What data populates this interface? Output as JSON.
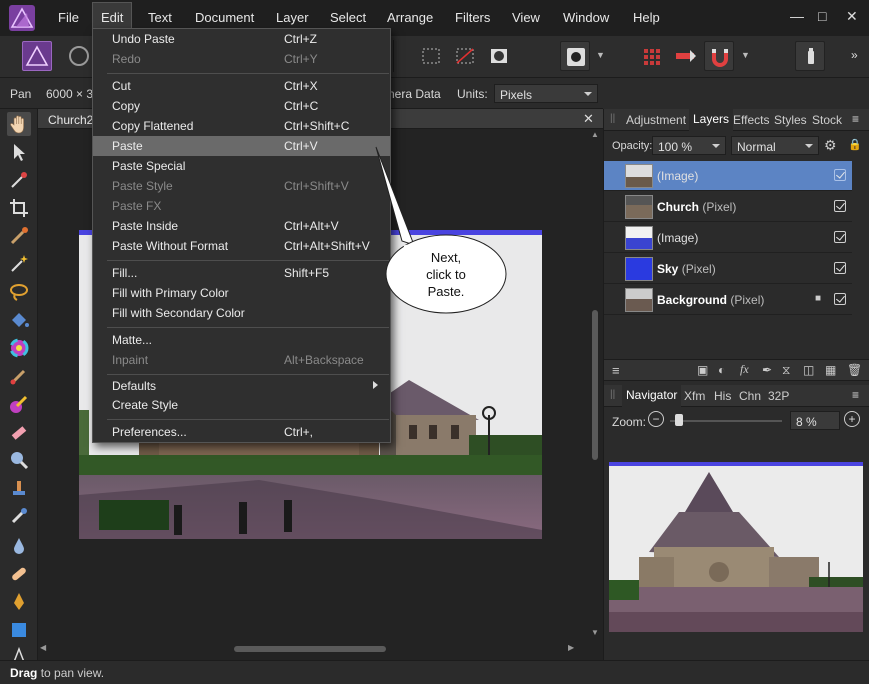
{
  "menubar": {
    "items": [
      "File",
      "Edit",
      "Text",
      "Document",
      "Layer",
      "Select",
      "Arrange",
      "Filters",
      "View",
      "Window",
      "Help"
    ]
  },
  "context_bar": {
    "tool_name": "Pan",
    "doc_size": "6000 × 3",
    "camera_data": "nera Data",
    "units_label": "Units:",
    "units_value": "Pixels"
  },
  "document": {
    "tab_label": "Church2"
  },
  "edit_menu": {
    "items": [
      {
        "label": "Undo Paste",
        "shortcut": "Ctrl+Z",
        "disabled": false
      },
      {
        "label": "Redo",
        "shortcut": "Ctrl+Y",
        "disabled": true
      },
      {
        "label": "Cut",
        "shortcut": "Ctrl+X",
        "disabled": false
      },
      {
        "label": "Copy",
        "shortcut": "Ctrl+C",
        "disabled": false
      },
      {
        "label": "Copy Flattened",
        "shortcut": "Ctrl+Shift+C",
        "disabled": false
      },
      {
        "label": "Paste",
        "shortcut": "Ctrl+V",
        "disabled": false,
        "highlighted": true
      },
      {
        "label": "Paste Special",
        "shortcut": "",
        "disabled": false
      },
      {
        "label": "Paste Style",
        "shortcut": "Ctrl+Shift+V",
        "disabled": true
      },
      {
        "label": "Paste FX",
        "shortcut": "",
        "disabled": true
      },
      {
        "label": "Paste Inside",
        "shortcut": "Ctrl+Alt+V",
        "disabled": false
      },
      {
        "label": "Paste Without Format",
        "shortcut": "Ctrl+Alt+Shift+V",
        "disabled": false
      },
      {
        "label": "Fill...",
        "shortcut": "Shift+F5",
        "disabled": false
      },
      {
        "label": "Fill with Primary Color",
        "shortcut": "",
        "disabled": false
      },
      {
        "label": "Fill with Secondary Color",
        "shortcut": "",
        "disabled": false
      },
      {
        "label": "Matte...",
        "shortcut": "",
        "disabled": false
      },
      {
        "label": "Inpaint",
        "shortcut": "Alt+Backspace",
        "disabled": true
      },
      {
        "label": "Defaults",
        "shortcut": "",
        "disabled": false,
        "submenu": true
      },
      {
        "label": "Create Style",
        "shortcut": "",
        "disabled": false
      },
      {
        "label": "Preferences...",
        "shortcut": "Ctrl+,",
        "disabled": false
      }
    ]
  },
  "callout": {
    "line1": "Next,",
    "line2": "click to",
    "line3": "Paste."
  },
  "top_panel": {
    "tabs": [
      "Adjustment",
      "Layers",
      "Effects",
      "Styles",
      "Stock"
    ],
    "active_tab": "Layers",
    "opacity_label": "Opacity:",
    "opacity_value": "100 %",
    "blend_mode": "Normal",
    "layers": [
      {
        "name": "(Image)",
        "kind": "",
        "bold": false,
        "selected": true,
        "locked": false
      },
      {
        "name": "Church",
        "kind": "(Pixel)",
        "bold": true,
        "selected": false,
        "locked": false
      },
      {
        "name": "(Image)",
        "kind": "",
        "bold": false,
        "selected": false,
        "locked": false
      },
      {
        "name": "Sky",
        "kind": "(Pixel)",
        "bold": true,
        "selected": false,
        "locked": false
      },
      {
        "name": "Background",
        "kind": "(Pixel)",
        "bold": true,
        "selected": false,
        "locked": true
      }
    ]
  },
  "bottom_panel": {
    "tabs": [
      "Navigator",
      "Xfm",
      "His",
      "Chn",
      "32P"
    ],
    "active_tab": "Navigator",
    "zoom_label": "Zoom:",
    "zoom_value": "8 %",
    "zoom_fraction": 0.05
  },
  "status": {
    "bold": "Drag",
    "rest": "to pan view."
  },
  "colors": {
    "accent_selected": "#5c84c4",
    "menu_highlight": "#6a6a6a"
  }
}
